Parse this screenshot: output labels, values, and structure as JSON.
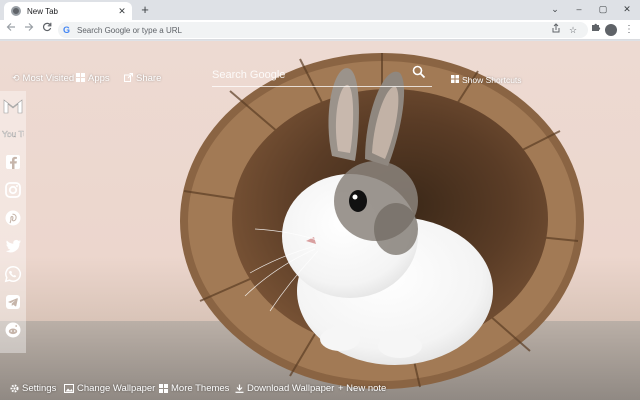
{
  "browser": {
    "tab": {
      "title": "New Tab",
      "close_icon": "close-icon"
    },
    "new_tab_label": "+",
    "omnibox": {
      "placeholder": "Search Google or type a URL"
    },
    "window_controls": {
      "minimize": "⌄",
      "restore": "–",
      "maximize": "▢",
      "close": "✕"
    }
  },
  "page": {
    "top_links": {
      "most_visited": "Most Visited",
      "apps": "Apps",
      "share": "Share",
      "show_shortcuts": "Show Shortcuts"
    },
    "search": {
      "placeholder": "Search Google"
    },
    "sidebar": {
      "items": [
        {
          "name": "gmail-icon"
        },
        {
          "name": "youtube-icon",
          "label": "You Tube"
        },
        {
          "name": "facebook-icon"
        },
        {
          "name": "instagram-icon"
        },
        {
          "name": "pinterest-icon"
        },
        {
          "name": "twitter-icon"
        },
        {
          "name": "whatsapp-icon"
        },
        {
          "name": "telegram-icon"
        },
        {
          "name": "reddit-icon"
        }
      ]
    },
    "bottom_bar": {
      "settings": "Settings",
      "change_wallpaper": "Change Wallpaper",
      "more_themes": "More Themes",
      "download_wallpaper": "Download Wallpaper",
      "new_note": "+ New note"
    },
    "wallpaper": {
      "subject": "rabbit-in-wooden-barrel"
    }
  }
}
